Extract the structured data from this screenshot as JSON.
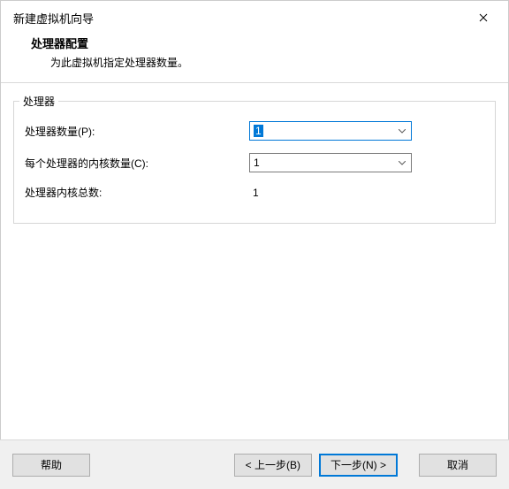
{
  "window": {
    "title": "新建虚拟机向导"
  },
  "header": {
    "title": "处理器配置",
    "subtitle": "为此虚拟机指定处理器数量。"
  },
  "groupbox": {
    "legend": "处理器"
  },
  "form": {
    "processors_label": "处理器数量(P):",
    "processors_value": "1",
    "cores_label": "每个处理器的内核数量(C):",
    "cores_value": "1",
    "total_label": "处理器内核总数:",
    "total_value": "1"
  },
  "footer": {
    "help": "帮助",
    "back": "< 上一步(B)",
    "next": "下一步(N) >",
    "cancel": "取消"
  }
}
